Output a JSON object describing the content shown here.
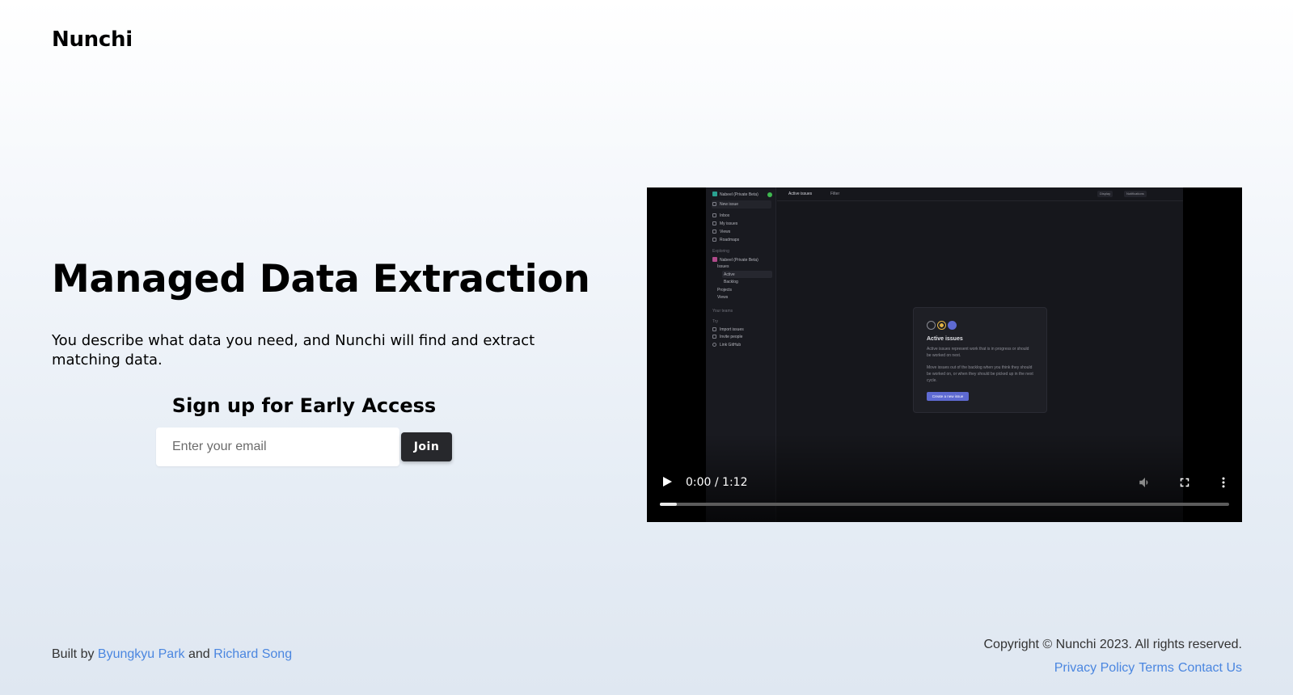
{
  "header": {
    "brand": "Nunchi"
  },
  "hero": {
    "title": "Managed Data Extraction",
    "subtitle": "You describe what data you need, and Nunchi will find and extract matching data."
  },
  "signup": {
    "title": "Sign up for Early Access",
    "email_placeholder": "Enter your email",
    "email_value": "",
    "join_label": "Join"
  },
  "video": {
    "time": "0:00 / 1:12",
    "progress_fraction": 0.03,
    "preview": {
      "workspace": "Nabeel (Private Beta)",
      "new_issue": "New issue",
      "nav": [
        "Inbox",
        "My issues",
        "Views",
        "Roadmaps"
      ],
      "section_label": "Exploring",
      "team": "Nabeel (Private Beta)",
      "team_items": [
        "Issues",
        "Active",
        "Backlog",
        "Projects",
        "Views"
      ],
      "your_teams": "Your teams",
      "try_label": "Try",
      "try_items": [
        "Import issues",
        "Invite people",
        "Link GitHub"
      ],
      "top_title": "Active issues",
      "filter": "Filter",
      "display": "Display",
      "notifications": "Notifications",
      "card_title": "Active issues",
      "card_p1": "Active issues represent work that is in progress or should be worked on next.",
      "card_p2": "Move issues out of the backlog when you think they should be worked on, or when they should be picked up in the next cycle.",
      "card_button": "Create a new issue"
    }
  },
  "footer": {
    "built_by": "Built by",
    "author1": "Byungkyu Park",
    "and": "and",
    "author2": "Richard Song",
    "copyright": "Copyright © Nunchi 2023. All rights reserved.",
    "links": [
      "Privacy Policy",
      "Terms",
      "Contact Us"
    ]
  },
  "colors": {
    "link": "#4a86e0",
    "button_dark": "#27282c",
    "accent_purple": "#5e6ad2"
  }
}
